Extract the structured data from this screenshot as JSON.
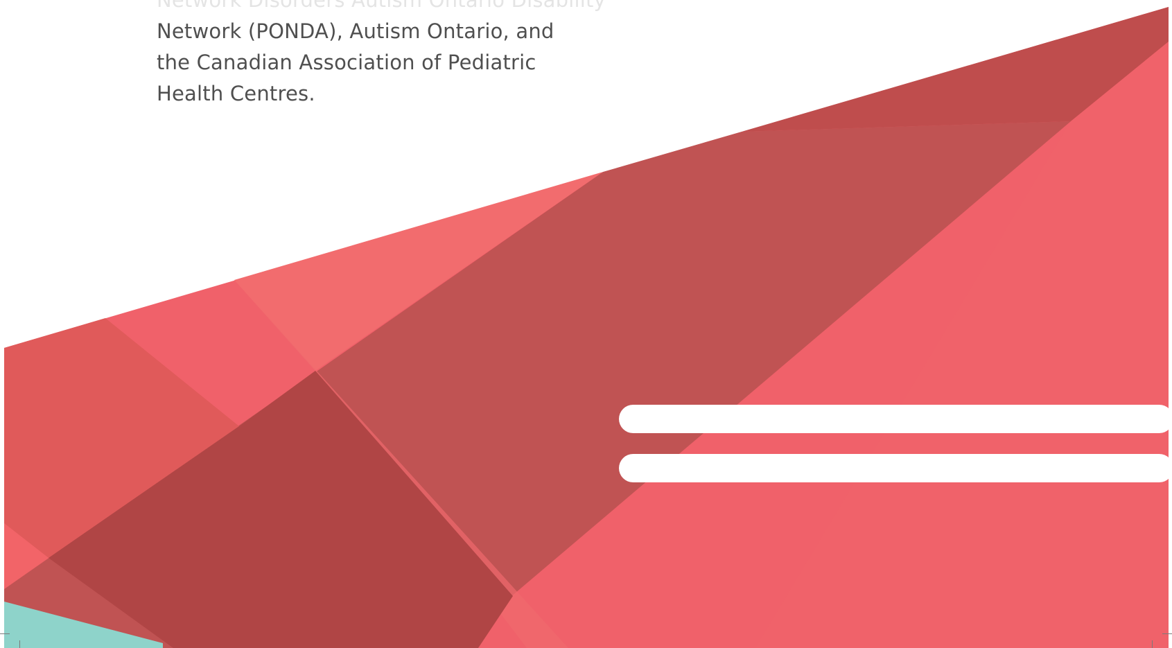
{
  "document": {
    "text_lines": [
      "",
      "Network (PONDA), Autism Ontario, and",
      "the Canadian Association of Pediatric",
      "Health Centres."
    ]
  },
  "decoration": {
    "colors": {
      "coral": "#F0616A",
      "coral_light": "#F26C6E",
      "red_mid": "#E05A5A",
      "red_dark": "#C05050",
      "red_deep": "#B04444",
      "teal": "#8ED3CA",
      "bars": "#FFFFFF"
    },
    "bars": 2
  }
}
